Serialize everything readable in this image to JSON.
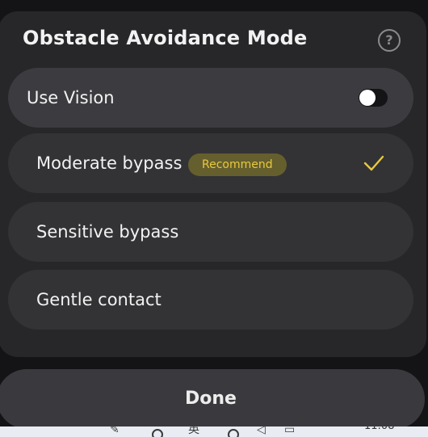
{
  "dialog": {
    "title": "Obstacle Avoidance Mode"
  },
  "vision": {
    "label": "Use Vision",
    "enabled": false
  },
  "options": [
    {
      "label": "Moderate bypass",
      "badge": "Recommend",
      "selected": true
    },
    {
      "label": "Sensitive bypass",
      "selected": false
    },
    {
      "label": "Gentle contact",
      "selected": false
    }
  ],
  "done": {
    "label": "Done"
  },
  "taskbar": {
    "clock": "11:08",
    "ime": "英"
  },
  "colors": {
    "dialog_bg": "#27272a",
    "row_bg": "#333336",
    "badge_bg": "#655f2e",
    "accent_yellow": "#e8c93e"
  }
}
